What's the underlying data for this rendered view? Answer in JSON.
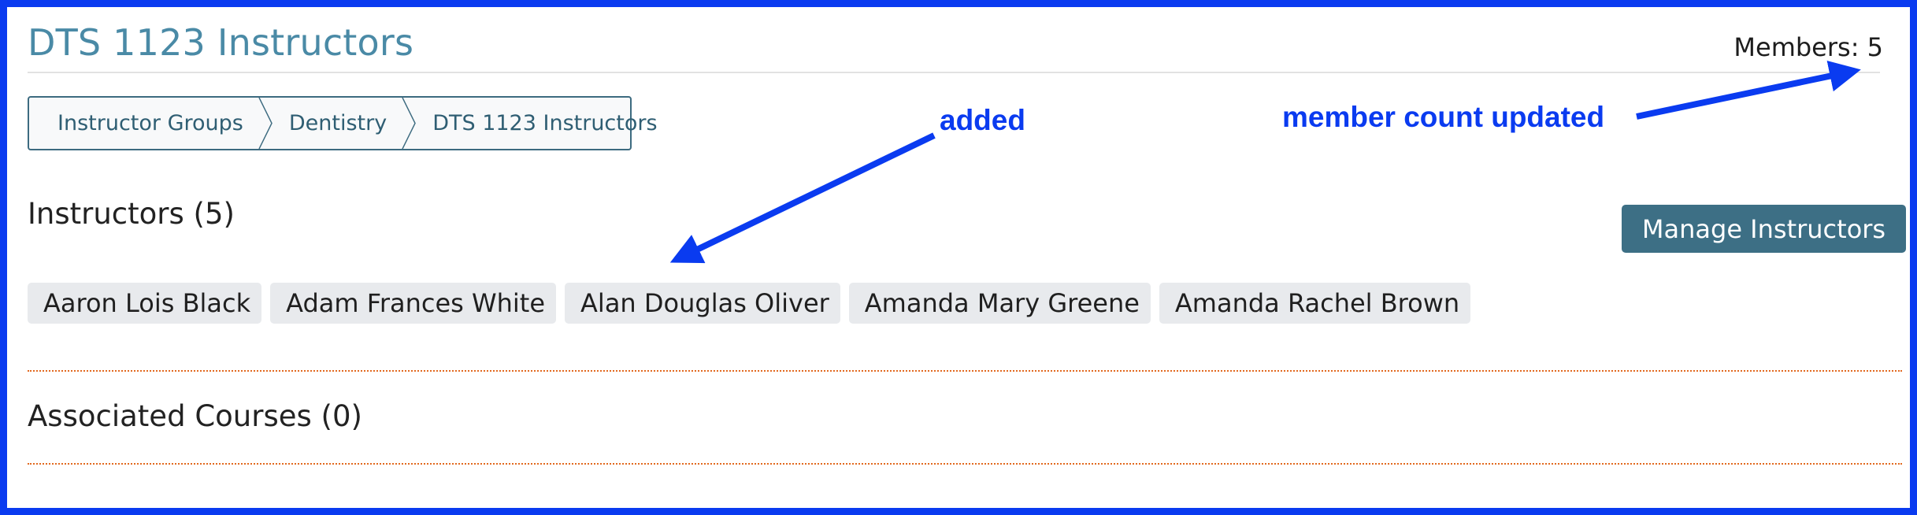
{
  "page": {
    "title": "DTS 1123 Instructors",
    "members_label": "Members: 5"
  },
  "breadcrumb": {
    "items": [
      "Instructor Groups",
      "Dentistry",
      "DTS 1123 Instructors"
    ]
  },
  "instructors": {
    "heading": "Instructors (5)",
    "manage_label": "Manage Instructors",
    "names": [
      "Aaron Lois Black",
      "Adam Frances White",
      "Alan Douglas Oliver",
      "Amanda Mary Greene",
      "Amanda Rachel Brown"
    ]
  },
  "courses": {
    "heading": "Associated Courses (0)"
  },
  "annotations": {
    "added": "added",
    "member_count": "member count updated"
  },
  "colors": {
    "annotation": "#0a3bf0",
    "title": "#4a8aa6",
    "button": "#3d6f85",
    "divider": "#e2691f"
  }
}
